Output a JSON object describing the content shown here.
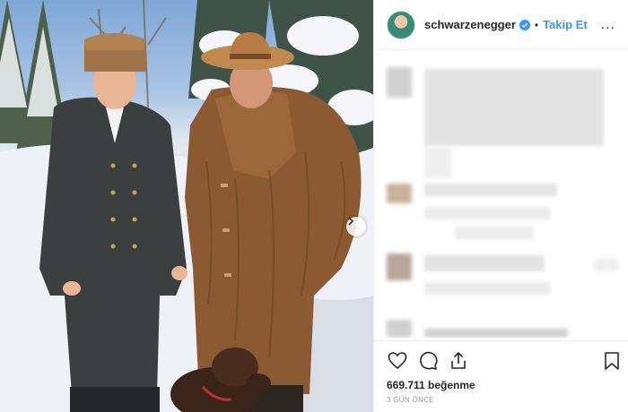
{
  "post": {
    "username": "schwarzenegger",
    "follow_label": "Takip Et",
    "separator": "•",
    "more_label": "...",
    "likes_text": "669.711 beğenme",
    "time_text": "3 GÜN ÖNCE"
  },
  "icons": {
    "verified": "verified-badge-icon",
    "like": "heart-icon",
    "comment": "comment-icon",
    "share": "share-icon",
    "save": "bookmark-icon",
    "next": "chevron-right-icon"
  },
  "colors": {
    "follow": "#3897f0",
    "verified": "#3897f0",
    "text": "#262626",
    "muted": "#999999"
  }
}
